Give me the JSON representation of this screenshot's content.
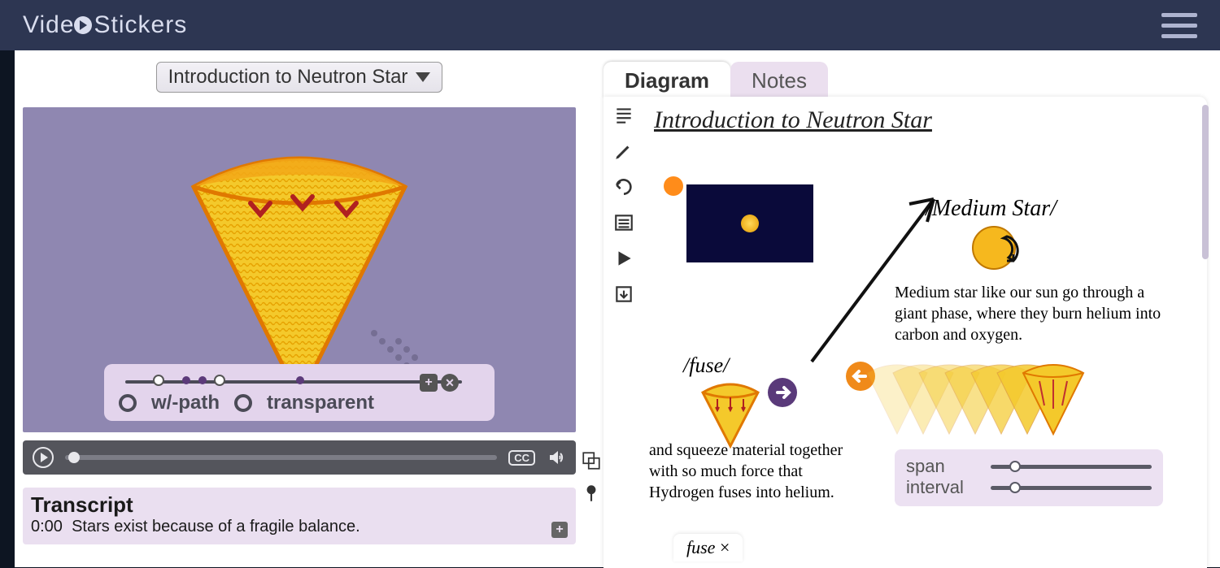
{
  "app": {
    "brand_pre": "Vide",
    "brand_post": " Stickers"
  },
  "video_selector": {
    "selected": "Introduction to Neutron Star"
  },
  "sticker_bar": {
    "opt_wpath": "w/-path",
    "opt_transparent": "transparent"
  },
  "player": {
    "cc": "CC"
  },
  "transcript": {
    "heading": "Transcript",
    "time0": "0:00",
    "line0": "Stars exist because of a fragile balance."
  },
  "tabs": {
    "diagram": "Diagram",
    "notes": "Notes"
  },
  "diagram": {
    "title": "Introduction to Neutron Star",
    "medium_label": "/Medium Star/",
    "medium_text": "Medium star like our sun go through a giant phase, where they burn helium into carbon and oxygen.",
    "fuse_label": "/fuse/",
    "fuse_text": "and squeeze material together with so much force that Hydrogen fuses into helium.",
    "slider_span": "span",
    "slider_interval": "interval",
    "bottom_chip": "fuse"
  }
}
